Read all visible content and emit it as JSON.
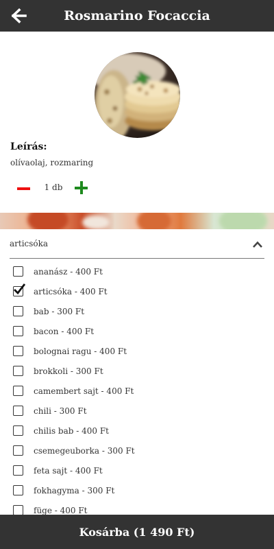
{
  "header": {
    "title": "Rosmarino Focaccia",
    "back_icon": "arrow-left-icon"
  },
  "product": {
    "image": "focaccia-photo",
    "description_label": "Leírás:",
    "description": "olívaolaj, rozmaring"
  },
  "quantity": {
    "value": "1 db",
    "minus_icon": "minus-icon",
    "plus_icon": "plus-icon",
    "minus_color": "#ee1111",
    "plus_color": "#1e8a1e"
  },
  "accordion": {
    "selected": "articsóka",
    "chevron_icon": "chevron-up-icon"
  },
  "toppings": [
    {
      "label": "ananász - 400 Ft",
      "checked": false
    },
    {
      "label": "articsóka - 400 Ft",
      "checked": true
    },
    {
      "label": "bab - 300 Ft",
      "checked": false
    },
    {
      "label": "bacon - 400 Ft",
      "checked": false
    },
    {
      "label": "bolognai ragu - 400 Ft",
      "checked": false
    },
    {
      "label": "brokkoli - 300 Ft",
      "checked": false
    },
    {
      "label": "camembert sajt - 400 Ft",
      "checked": false
    },
    {
      "label": "chili - 300 Ft",
      "checked": false
    },
    {
      "label": "chilis bab - 400 Ft",
      "checked": false
    },
    {
      "label": "csemegeuborka - 300 Ft",
      "checked": false
    },
    {
      "label": "feta sajt - 400 Ft",
      "checked": false
    },
    {
      "label": "fokhagyma - 300 Ft",
      "checked": false
    },
    {
      "label": "füge - 400 Ft",
      "checked": false
    }
  ],
  "footer": {
    "cart_label": "Kosárba (1 490 Ft)"
  },
  "colors": {
    "bar_background": "#333333",
    "text": "#333333"
  }
}
